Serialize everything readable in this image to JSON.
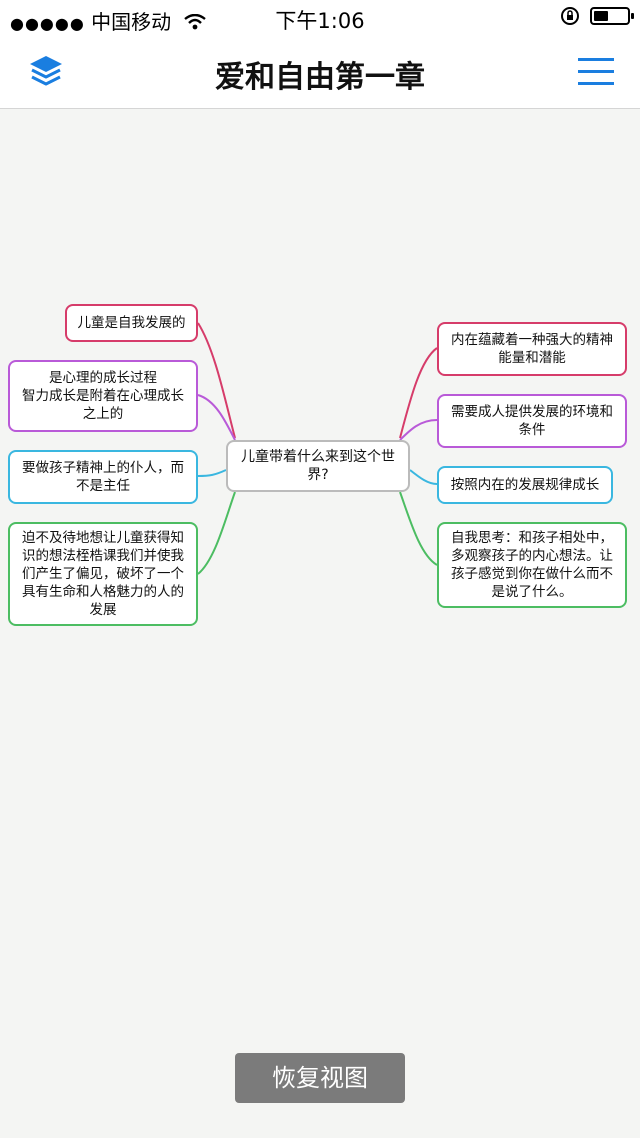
{
  "status_bar": {
    "carrier": "中国移动",
    "signal_dots": "●●●●●",
    "time": "下午1:06"
  },
  "nav": {
    "title": "爱和自由第一章"
  },
  "mindmap": {
    "center": "儿童带着什么来到这个世界?",
    "left": [
      {
        "text": "儿童是自我发展的",
        "color": "#d63c6a"
      },
      {
        "text": "是心理的成长过程\n智力成长是附着在心理成长之上的",
        "color": "#b95ad8"
      },
      {
        "text": "要做孩子精神上的仆人，而不是主任",
        "color": "#3ab7e0"
      },
      {
        "text": "迫不及待地想让儿童获得知识的想法桎梏课我们并使我们产生了偏见，破坏了一个具有生命和人格魅力的人的发展",
        "color": "#4cbd62"
      }
    ],
    "right": [
      {
        "text": "内在蕴藏着一种强大的精神能量和潜能",
        "color": "#d63c6a"
      },
      {
        "text": "需要成人提供发展的环境和条件",
        "color": "#b95ad8"
      },
      {
        "text": "按照内在的发展规律成长",
        "color": "#3ab7e0"
      },
      {
        "text": "自我思考：和孩子相处中，多观察孩子的内心想法。让孩子感觉到你在做什么而不是说了什么。",
        "color": "#4cbd62"
      }
    ]
  },
  "restore_button": "恢复视图",
  "icons": [
    "layers-icon",
    "menu-icon",
    "wifi-icon",
    "rotation-lock-icon",
    "battery-icon"
  ],
  "colors": {
    "accent": "#1a7ee0",
    "background": "#f4f5f3"
  }
}
